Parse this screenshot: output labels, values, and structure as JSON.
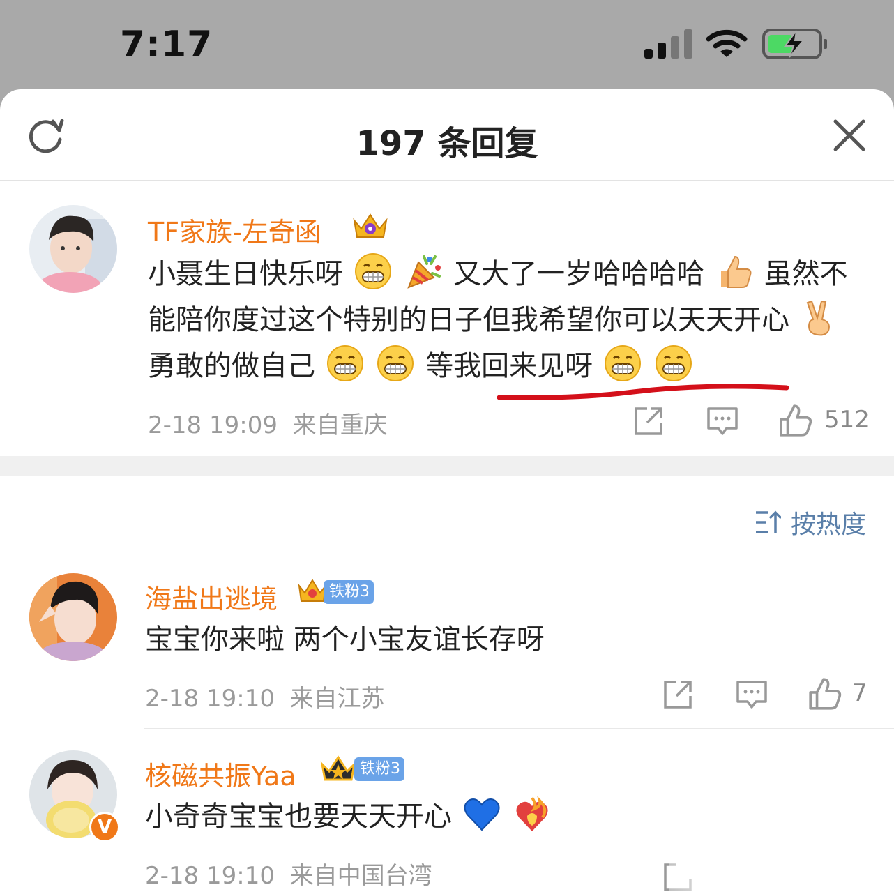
{
  "status": {
    "time": "7:17"
  },
  "header": {
    "title": "197 条回复"
  },
  "main_comment": {
    "username": "TF家族-左奇函",
    "text": {
      "p1": "小聂生日快乐呀",
      "p2": "又大了一岁哈哈哈哈",
      "p3": "虽然不能陪你度过这个特别的日子但我希望你可以天天开心",
      "p4": "勇敢的做自己",
      "p5": "等我回来见呀"
    },
    "date": "2-18 19:09",
    "location": "来自重庆",
    "likes": "512"
  },
  "sort": {
    "label": "按热度"
  },
  "replies": [
    {
      "username": "海盐出逃境",
      "badge": "铁粉3",
      "text": "宝宝你来啦 两个小宝友谊长存呀",
      "date": "2-18 19:10",
      "location": "来自江苏",
      "likes": "7"
    },
    {
      "username": "核磁共振Yaa",
      "badge": "铁粉3",
      "text": "小奇奇宝宝也要天天开心",
      "date": "2-18 19:10",
      "location": "来自中国台湾",
      "vip": "V"
    }
  ],
  "colors": {
    "username": "#f07818",
    "link": "#5a7fa9",
    "underline": "#d4101a"
  }
}
